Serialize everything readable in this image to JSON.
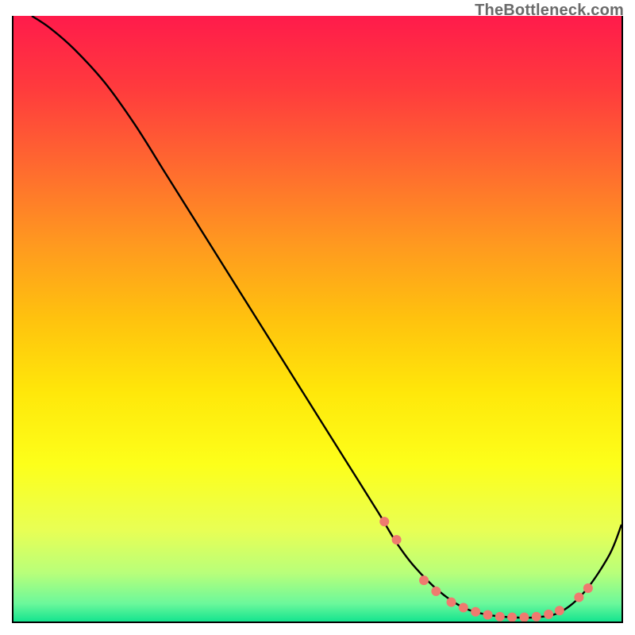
{
  "watermark": "TheBottleneck.com",
  "chart_data": {
    "type": "line",
    "title": "",
    "xlabel": "",
    "ylabel": "",
    "xlim": [
      0,
      100
    ],
    "ylim": [
      0,
      100
    ],
    "legend": false,
    "grid": false,
    "background_gradient": {
      "stops": [
        {
          "offset": 0.0,
          "color": "#ff1b4b"
        },
        {
          "offset": 0.12,
          "color": "#ff3b3d"
        },
        {
          "offset": 0.25,
          "color": "#ff6a2f"
        },
        {
          "offset": 0.38,
          "color": "#ff9a1f"
        },
        {
          "offset": 0.5,
          "color": "#ffc20e"
        },
        {
          "offset": 0.62,
          "color": "#ffe70a"
        },
        {
          "offset": 0.74,
          "color": "#fdff1a"
        },
        {
          "offset": 0.85,
          "color": "#e8ff55"
        },
        {
          "offset": 0.92,
          "color": "#b8ff7a"
        },
        {
          "offset": 0.97,
          "color": "#6cf89b"
        },
        {
          "offset": 1.0,
          "color": "#15e48f"
        }
      ]
    },
    "series": [
      {
        "name": "bottleneck_curve",
        "color": "#000000",
        "x": [
          3,
          6,
          10,
          15,
          20,
          25,
          30,
          35,
          40,
          45,
          50,
          55,
          60,
          63,
          66,
          70,
          74,
          78,
          82,
          86,
          90,
          94,
          98,
          100
        ],
        "y": [
          100,
          98,
          94.5,
          89,
          82,
          74,
          66,
          58,
          50,
          42,
          34,
          26,
          18,
          13,
          9,
          5,
          2.3,
          1.1,
          0.7,
          0.7,
          1.6,
          5,
          11,
          16
        ]
      }
    ],
    "markers": {
      "name": "highlight_dots",
      "color": "#ef7a6f",
      "radius_px": 6,
      "points": [
        {
          "x": 61.0,
          "y": 16.5
        },
        {
          "x": 63.0,
          "y": 13.5
        },
        {
          "x": 67.5,
          "y": 6.8
        },
        {
          "x": 69.5,
          "y": 5.0
        },
        {
          "x": 72.0,
          "y": 3.2
        },
        {
          "x": 74.0,
          "y": 2.3
        },
        {
          "x": 76.0,
          "y": 1.6
        },
        {
          "x": 78.0,
          "y": 1.1
        },
        {
          "x": 80.0,
          "y": 0.8
        },
        {
          "x": 82.0,
          "y": 0.7
        },
        {
          "x": 84.0,
          "y": 0.7
        },
        {
          "x": 86.0,
          "y": 0.8
        },
        {
          "x": 88.0,
          "y": 1.2
        },
        {
          "x": 89.8,
          "y": 1.8
        },
        {
          "x": 93.0,
          "y": 4.0
        },
        {
          "x": 94.5,
          "y": 5.5
        }
      ]
    }
  }
}
